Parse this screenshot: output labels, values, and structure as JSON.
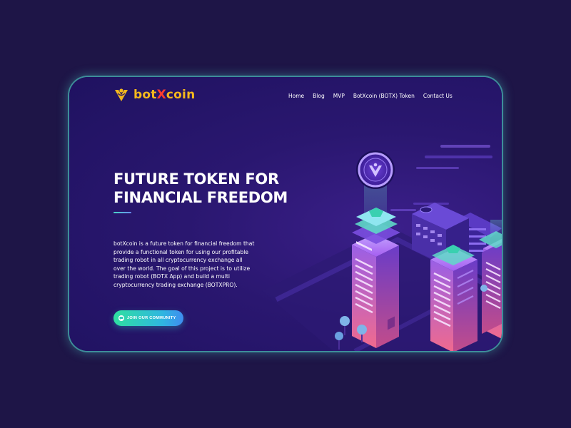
{
  "brand": {
    "part1": "bot",
    "part2": "X",
    "part3": "coin",
    "colors": {
      "yellow": "#f4b81c",
      "red": "#ff3c2e"
    },
    "icon": "botxcoin-logo-icon"
  },
  "nav": {
    "items": [
      "Home",
      "Blog",
      "MVP",
      "BotXcoin (BOTX) Token",
      "Contact Us"
    ]
  },
  "hero": {
    "title_line1": "FUTURE TOKEN FOR",
    "title_line2": "FINANCIAL FREEDOM",
    "description": "botXcoin is a future token for financial freedom that provide a functional token for using our profitable trading robot in all cryptocurrency exchange all over the world. The goal of this project is to utilize trading robot (BOTX App) and build a multi cryptocurrency trading exchange (BOTXPRO).",
    "cta_label": "JOIN OUR COMMUNITY",
    "cta_icon": "chat-bubble-icon"
  },
  "theme": {
    "page_bg": "#1e1547",
    "card_bg": "#2a1770",
    "accent_teal": "#4ad4c7",
    "accent_pink": "#e05a9a"
  }
}
